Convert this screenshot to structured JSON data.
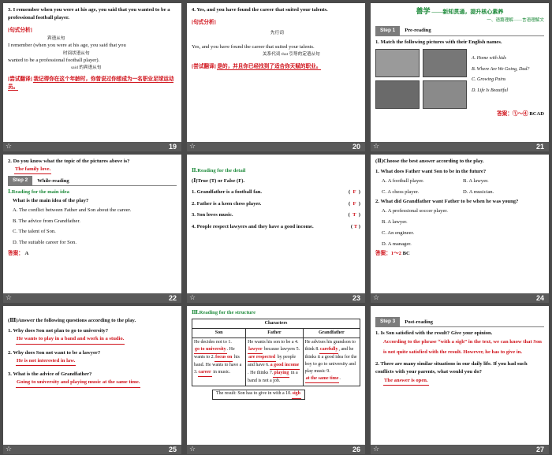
{
  "slides": {
    "s19": {
      "number": "19",
      "sentence": "3.  I remember when you were at his age, you said that you wanted to be a professional football player.",
      "analysis_label": "[句式分析]",
      "note_top": "宾语从句",
      "parse_line1": "I remember (when you were at his age, you said that you",
      "note_mid": "时间状语从句",
      "parse_line2": "wanted to be a professional football player).",
      "note_bottom": "said 的宾语从句",
      "translation_label": "[尝试翻译]",
      "translation": "我记得你在这个年龄时，你曾说过你想成为一名职业足球运动员。"
    },
    "s20": {
      "number": "20",
      "sentence": "4.  Yes, and you have found the career that suited your talents.",
      "analysis_label": "[句式分析]",
      "note_top": "先行词",
      "parse_line": "Yes, and you have found the career that suited your talents.",
      "note_bottom": "关系代词 that 引导的定语从句",
      "translation_label": "[尝试翻译]",
      "translation": "是的，并且你已经找到了适合你天赋的职业。"
    },
    "s21": {
      "number": "21",
      "banner_main": "善学",
      "banner_sub": "——新知贯通，提升核心素养",
      "banner_sub2": "一、语篇理解——言语理解文",
      "step": "Step 1",
      "step_label": "Pre-reading",
      "question": "1.  Match the following pictures with their English names.",
      "options": [
        "A.  Home with kids",
        "B.  Where Are We Going, Dad?",
        "C.  Growing Pains",
        "D.  Life Is Beautiful"
      ],
      "answer_label": "答案：①～④",
      "answer": "BCAD"
    },
    "s22": {
      "number": "22",
      "q2": "2.  Do you know what the topic of the pictures above is?",
      "q2_answer": "The family love.",
      "step": "Step 2",
      "step_label": "While-reading",
      "section": "Ⅰ.Reading for the main idea",
      "question": "What is the main idea of the play?",
      "options": [
        "A.  The conflict between Father and Son about the career.",
        "B.  The advice from Grandfather.",
        "C.  The talent of Son.",
        "D.  The suitable career for Son."
      ],
      "answer_label": "答案：",
      "answer": "A"
    },
    "s23": {
      "number": "23",
      "section": "Ⅱ.Reading for the detail",
      "instruction": "(Ⅰ)True (T) or False (F).",
      "items": [
        {
          "text": "1.  Grandfather is a football fan.",
          "mark": "F"
        },
        {
          "text": "2.  Father is a keen chess player.",
          "mark": "F"
        },
        {
          "text": "3.  Son loves music.",
          "mark": "T"
        },
        {
          "text": "4.  People respect lawyers and they have a good income.",
          "mark": "T"
        }
      ]
    },
    "s24": {
      "number": "24",
      "instruction": "(Ⅱ)Choose the best answer according to the play.",
      "q1": "1.  What does Father want Son to be in the future?",
      "q1_options": [
        "A.  A football player.",
        "B.  A lawyer.",
        "C.  A chess player.",
        "D.  A musician."
      ],
      "q2": "2.  What did Grandfather want Father to be when he was young?",
      "q2_options": [
        "A.  A professional soccer player.",
        "B.  A lawyer.",
        "C.  An engineer.",
        "D.  A manager."
      ],
      "answer_label": "答案：1～2",
      "answer": "BC"
    },
    "s25": {
      "number": "25",
      "instruction": "(Ⅲ)Answer the following questions according to the play.",
      "q1": "1.  Why does Son not plan to go to university?",
      "a1": "He wants to play in a band and work in a studio.",
      "q2": "2.  Why does Son not want to be a lawyer?",
      "a2": "He is not interested in law.",
      "q3": "3.  What is the advice of Grandfather?",
      "a3": "Going to university and playing music at the same time."
    },
    "s26": {
      "number": "26",
      "section": "Ⅲ.Reading for the structure",
      "table_title": "Characters",
      "headers": [
        "Son",
        "Father",
        "Grandfather"
      ],
      "son": [
        "He decides not to 1.",
        "go to university",
        ". He wants to 2.",
        "focus on",
        " his band. He wants to have a 3.",
        "career",
        " in music."
      ],
      "father": [
        "He wants his son to be a 4.",
        "lawyer",
        " because lawyers 5.",
        "are respected",
        " by people and have 6.",
        "a good income",
        ". He thinks 7.",
        "playing",
        " in a band is not a job."
      ],
      "grandfather": [
        "He advises his grandson to think 8.",
        "carefully",
        ", and he thinks it a good idea for the boy to go to university and play music 9.",
        "at the same time",
        "."
      ],
      "result_prefix": "The result:  Son has to give in with a 10.",
      "result_answer": "sigh"
    },
    "s27": {
      "number": "27",
      "step": "Step 3",
      "step_label": "Post-reading",
      "q1": "1.  Is Son satisfied with the result? Give your opinion.",
      "a1": "According to the phrase “with a sigh” in the text, we can know that Son is not quite satisfied with the result. However, he has to give in.",
      "q2": "2.  There are many similar situations in our daily life. If you had such conflicts with your parents, what would you do?",
      "a2": "The answer is open."
    }
  },
  "icons": {
    "footer_icon": "star-icon"
  },
  "colors": {
    "answer_red": "#d0131b",
    "step_gray": "#7c7c7c",
    "footer": "#5a5a5a",
    "banner_green": "#1d8a3a"
  }
}
